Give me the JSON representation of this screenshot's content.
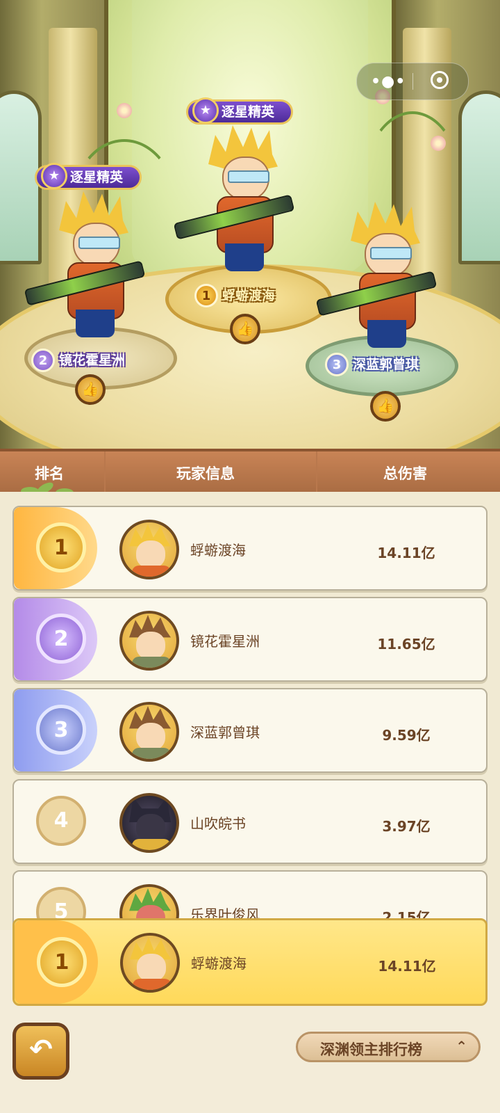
{
  "podium": {
    "badge_title": "逐星精英",
    "players": [
      {
        "rank": "1",
        "name": "蜉蝣渡海"
      },
      {
        "rank": "2",
        "name": "镜花霍星洲"
      },
      {
        "rank": "3",
        "name": "深蓝郭曾琪"
      }
    ]
  },
  "list_header": {
    "rank": "排名",
    "player_info": "玩家信息",
    "total_damage": "总伤害"
  },
  "rows": [
    {
      "rank": "1",
      "name": "蜉蝣渡海",
      "damage": "14.11亿"
    },
    {
      "rank": "2",
      "name": "镜花霍星洲",
      "damage": "11.65亿"
    },
    {
      "rank": "3",
      "name": "深蓝郭曾琪",
      "damage": "9.59亿"
    },
    {
      "rank": "4",
      "name": "山吹皖书",
      "damage": "3.97亿"
    },
    {
      "rank": "5",
      "name": "乐界叶俊风",
      "damage": "2.15亿"
    }
  ],
  "my_rank": {
    "rank": "1",
    "name": "蜉蝣渡海",
    "damage": "14.11亿"
  },
  "bottom": {
    "leaderboard_label": "深渊领主排行榜"
  },
  "colors": {
    "gold": "#e0a221",
    "purple": "#8f63d6",
    "blue": "#6b79cc",
    "header_brown": "#b8774b",
    "text_brown": "#6b4426"
  }
}
